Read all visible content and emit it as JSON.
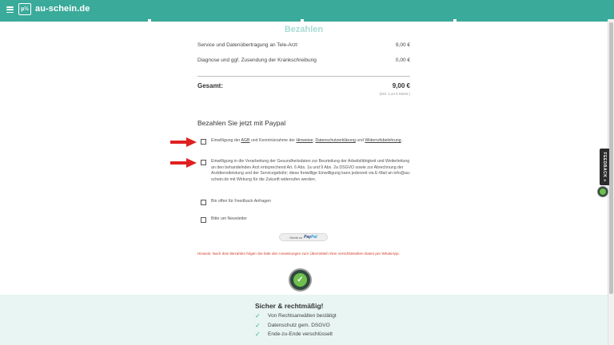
{
  "header": {
    "logo_glyph": "µ½",
    "site_name": "au-schein.de",
    "accent_color": "#3aaa9a"
  },
  "page": {
    "title": "Bezahlen"
  },
  "summary": {
    "items": [
      {
        "label": "Service und Datenübertragung an Tele-Arzt",
        "amount": "9,00 €"
      },
      {
        "label": "Diagnose und ggf. Zusendung der Krankschreibung",
        "amount": "0,00 €"
      }
    ],
    "total_label": "Gesamt:",
    "total_amount": "9,00 €",
    "vat_note": "(inkl. 1,44 € MwSt.)"
  },
  "payment": {
    "heading": "Bezahlen Sie jetzt mit Paypal",
    "consent1": {
      "pre": "Einwilligung der ",
      "link_agb": "AGB",
      "mid1": " und Kenntnisnahme der ",
      "link_hinweise": "Hinweise",
      "sep": ", ",
      "link_datenschutz": "Datenschutzerklärung",
      "mid2": " und ",
      "link_widerruf": "Widerrufsbelehrung",
      "post": " ."
    },
    "consent2": "Einwilligung in die Verarbeitung der Gesundheitsdaten zur Beurteilung der Arbeitsfähigkeit und Weiterleitung an den behandelnden Arzt entsprechend Art. 6 Abs. 1a und 9 Abs. 2a DSGVO sowie zur Abrechnung der Arztdienstleistung und der Servicegebühr; diese freiwillige Einwilligung kann jederzeit via E-Mail an info@au-schein.de mit Wirkung für die Zukunft widerrufen werden.",
    "feedback_option": "Bin offen für Feedback-Anfragen",
    "newsletter_option": "Bitte um Newsletter",
    "paypal_prefix": "Direkt zu",
    "paypal_brand_a": "Pay",
    "paypal_brand_b": "Pal",
    "note": "Hinweis: Nach dem Bezahlen folgen Sie bitte den Anweisungen zum Übermitteln Ihrer verschlüsselten Daten per WhatsApp."
  },
  "footer": {
    "title": "Sicher & rechtmäßig!",
    "points": [
      "Von Rechtsanwälten bestätigt",
      "Datenschutz gem. DSGVO",
      "Ende-zu-Ende verschlüsselt"
    ]
  },
  "feedback_tab": {
    "label": "FEEDBACK »"
  }
}
